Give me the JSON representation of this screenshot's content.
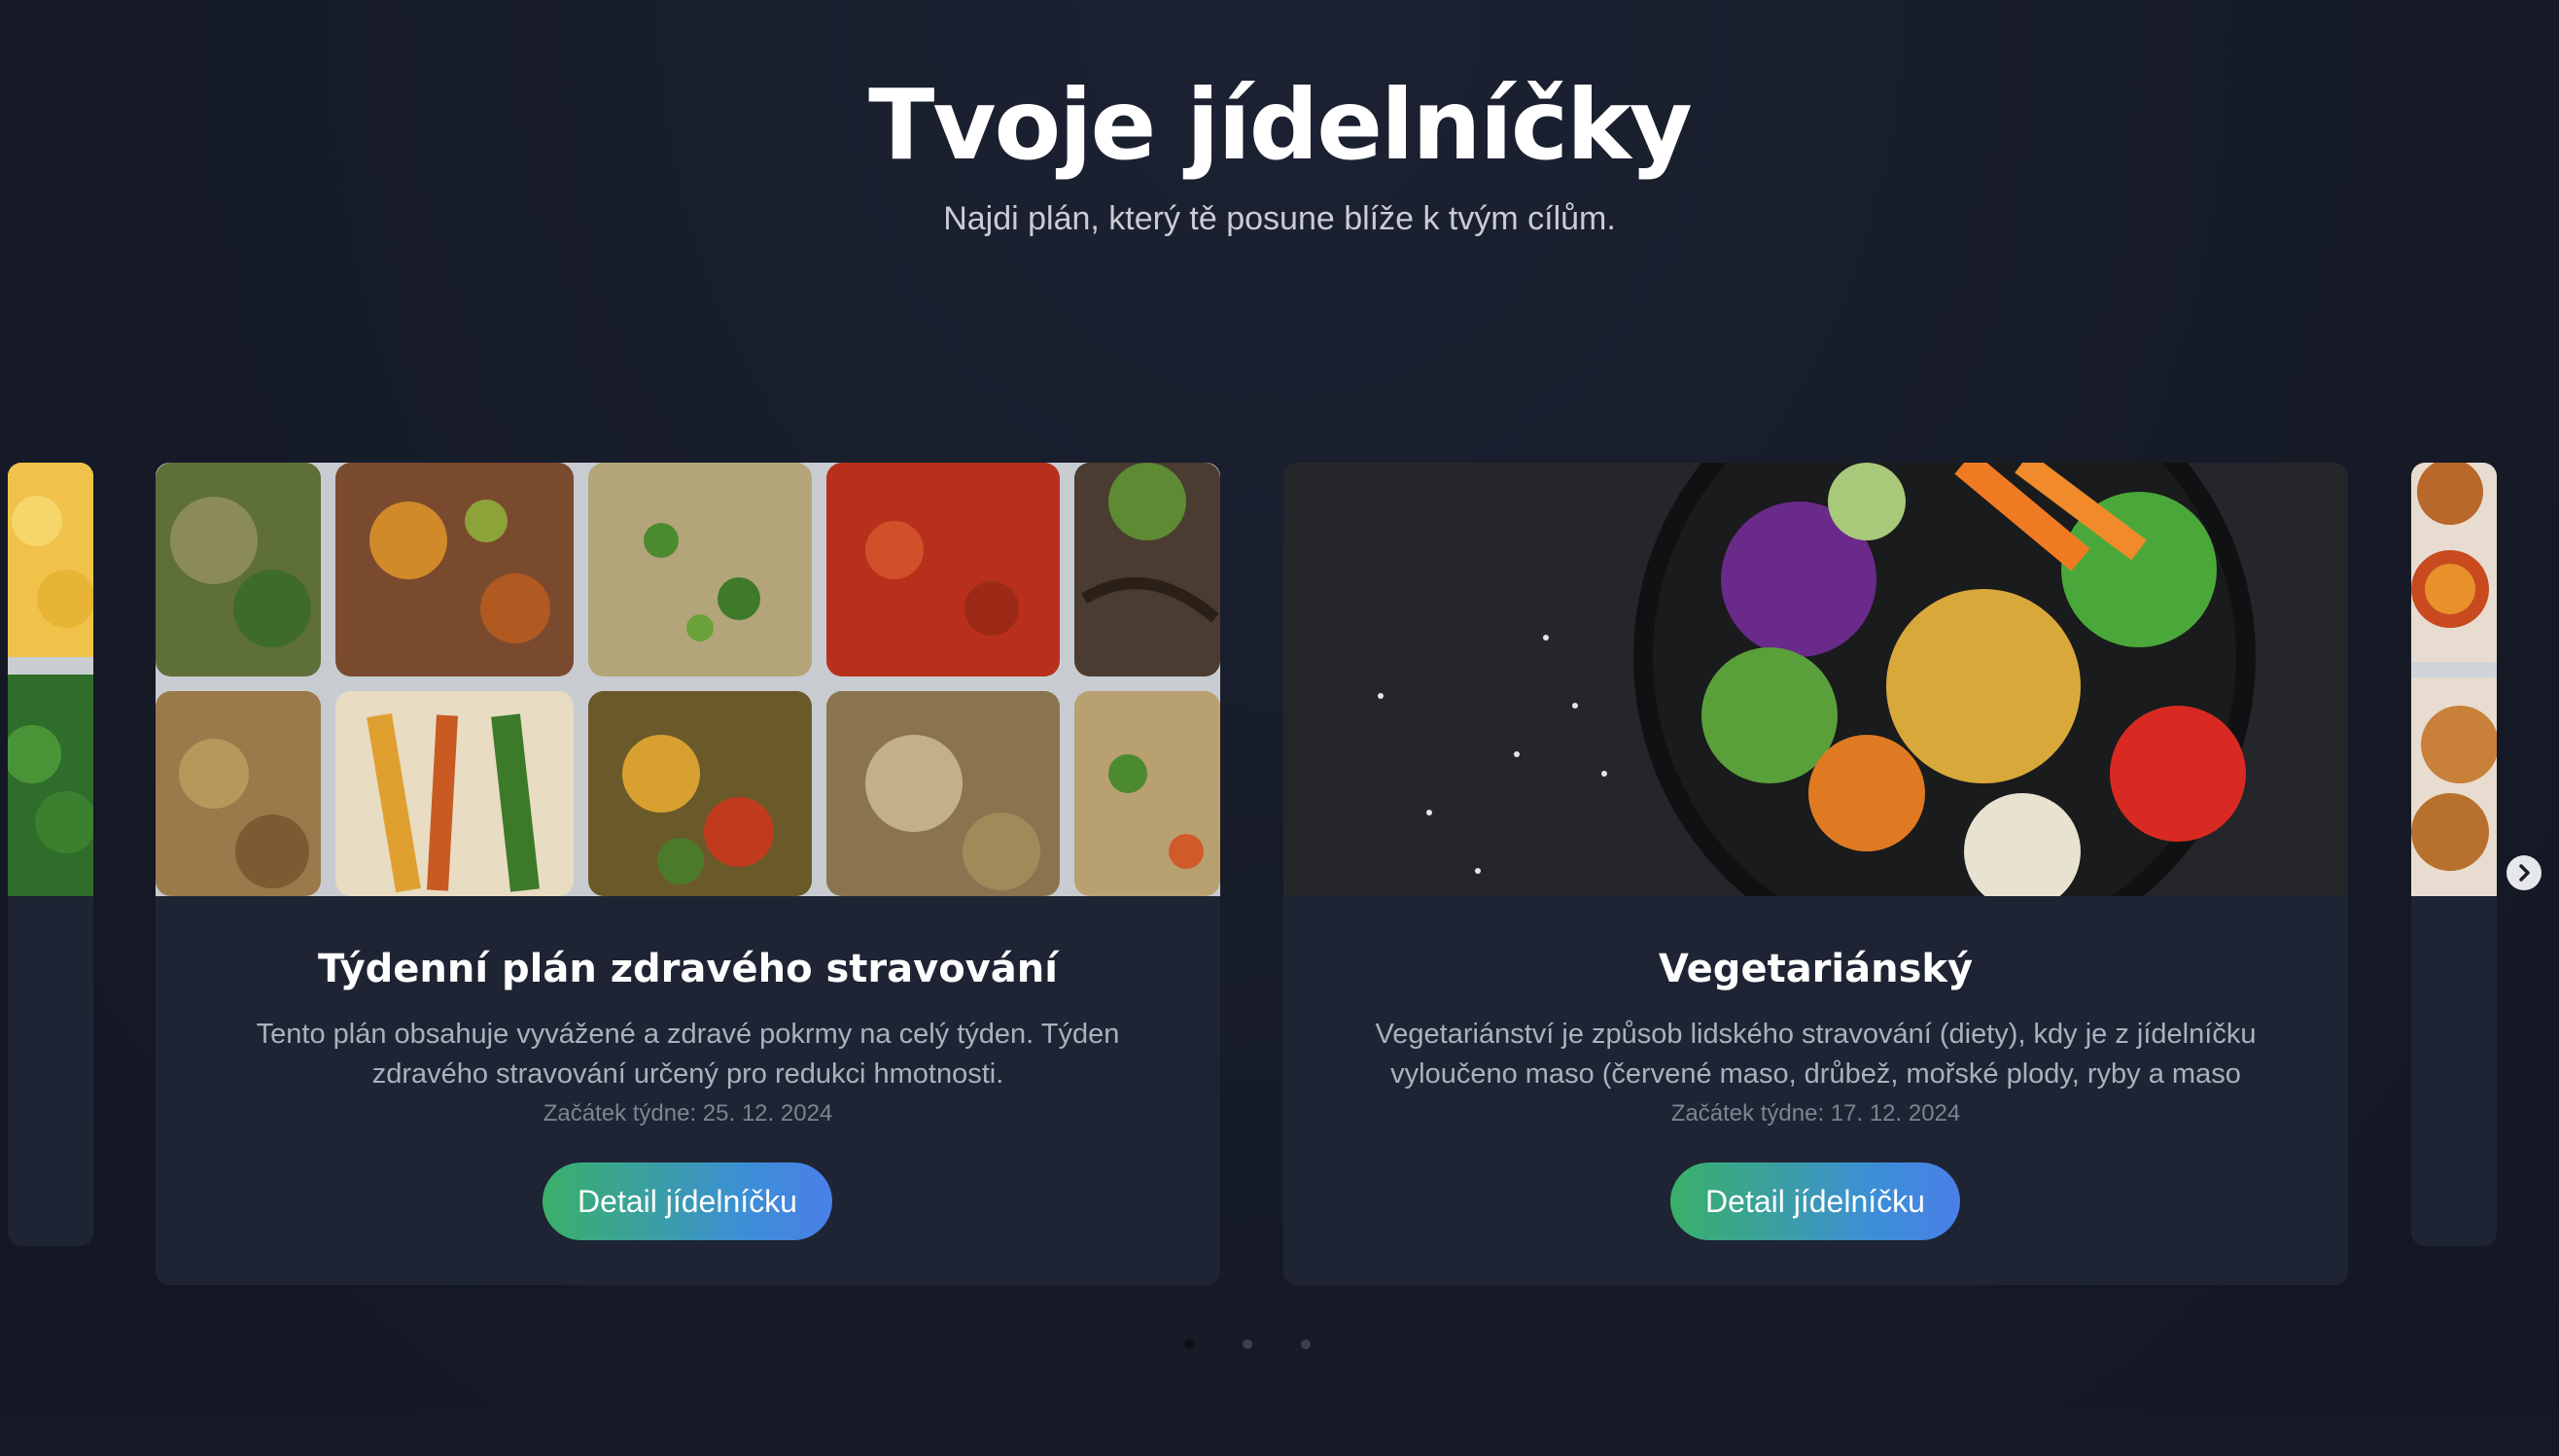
{
  "header": {
    "title": "Tvoje jídelníčky",
    "subtitle": "Najdi plán, který tě posune blíže k tvým cílům."
  },
  "carousel": {
    "cards": [
      {
        "title": "Týdenní plán zdravého stravování",
        "description": "Tento plán obsahuje vyvážené a zdravé pokrmy na celý týden. Týden zdravého stravování určený pro redukci hmotnosti.",
        "date": "Začátek týdne: 25. 12. 2024",
        "button": "Detail jídelníčku",
        "image": "meal-prep-containers-image"
      },
      {
        "title": "Vegetariánský",
        "description": "Vegetariánství je způsob lidského stravování (diety), kdy je z jídelníčku vyloučeno maso (červené maso, drůbež, mořské plody, ryby a maso",
        "date": "Začátek týdne: 17. 12. 2024",
        "button": "Detail jídelníčku",
        "image": "vegetarian-bowl-image"
      }
    ],
    "next_icon": "chevron-right-icon",
    "dots": {
      "count": 3,
      "active_index": 0
    }
  },
  "colors": {
    "background": "#171c29",
    "card": "#1e2433",
    "button_gradient_start": "#3ab06a",
    "button_gradient_end": "#4a7fe8"
  }
}
